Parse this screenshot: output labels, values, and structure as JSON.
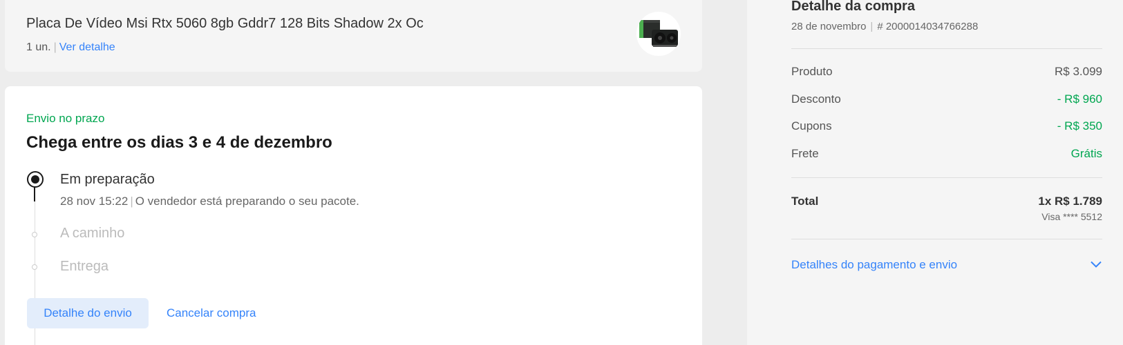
{
  "product": {
    "title": "Placa De Vídeo Msi Rtx 5060 8gb Gddr7 128 Bits Shadow 2x Oc",
    "quantity": "1 un.",
    "detail_link": "Ver detalhe",
    "image_icon": "graphics-card-thumbnail"
  },
  "shipping": {
    "status": "Envio no prazo",
    "heading": "Chega entre os dias 3 e 4 de dezembro",
    "steps": [
      {
        "title": "Em preparação",
        "time": "28 nov 15:22",
        "description": "O vendedor está preparando o seu pacote."
      },
      {
        "title": "A caminho"
      },
      {
        "title": "Entrega"
      }
    ],
    "primary_button": "Detalhe do envio",
    "cancel_link": "Cancelar compra"
  },
  "summary": {
    "title": "Detalhe da compra",
    "date": "28 de novembro",
    "order_number": "# 2000014034766288",
    "lines": [
      {
        "label": "Produto",
        "value": "R$ 3.099"
      },
      {
        "label": "Desconto",
        "value": "- R$ 960"
      },
      {
        "label": "Cupons",
        "value": "- R$ 350"
      },
      {
        "label": "Frete",
        "value": "Grátis"
      }
    ],
    "total_label": "Total",
    "total_value": "1x R$ 1.789",
    "card": "Visa **** 5512",
    "payment_link": "Detalhes do pagamento e envio"
  },
  "colors": {
    "accent": "#3483fa",
    "success": "#00a650",
    "page_bg": "#ededed",
    "muted": "#cccccc"
  }
}
